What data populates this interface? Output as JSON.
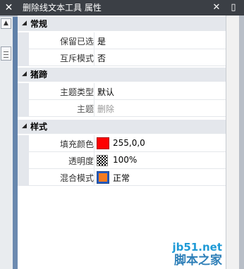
{
  "left": {
    "close_glyph": "✕",
    "up_glyph": "▲"
  },
  "panel": {
    "title": "删除线文本工具 属性",
    "close_glyph": "✕",
    "min_glyph": "▯"
  },
  "categories": [
    {
      "label": "常规"
    },
    {
      "label": "猪蹄"
    },
    {
      "label": "样式"
    }
  ],
  "props": {
    "keep_selected": {
      "name": "保留已选",
      "value": "是"
    },
    "mutex_mode": {
      "name": "互斥模式",
      "value": "否"
    },
    "theme_type": {
      "name": "主题类型",
      "value": "默认"
    },
    "theme": {
      "name": "主题",
      "value": "删除"
    },
    "fill_color": {
      "name": "填充颜色",
      "value": "255,0,0",
      "color": "#ff0000"
    },
    "opacity": {
      "name": "透明度",
      "value": "100%"
    },
    "blend_mode": {
      "name": "混合模式",
      "value": "正常"
    }
  },
  "watermark": {
    "url": "jb51.net",
    "brand": "脚本之家"
  }
}
